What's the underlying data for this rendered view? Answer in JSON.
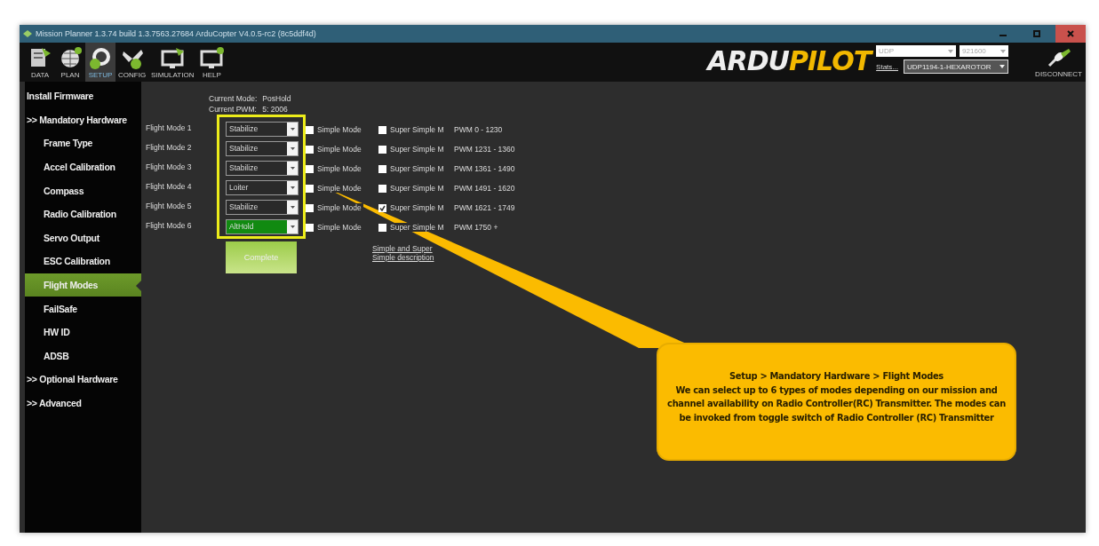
{
  "window": {
    "title": "Mission Planner 1.3.74 build 1.3.7563.27684 ArduCopter V4.0.5-rc2 (8c5ddf4d)"
  },
  "toolbar": {
    "items": [
      {
        "label": "DATA",
        "kind": "data",
        "selected": false
      },
      {
        "label": "PLAN",
        "kind": "plan",
        "selected": false
      },
      {
        "label": "SETUP",
        "kind": "setup",
        "selected": true
      },
      {
        "label": "CONFIG",
        "kind": "config",
        "selected": false
      },
      {
        "label": "SIMULATION",
        "kind": "simulation",
        "selected": false
      },
      {
        "label": "HELP",
        "kind": "help",
        "selected": false
      }
    ]
  },
  "logo": {
    "part_1": "ARDU",
    "part_2": "PILOT"
  },
  "connection": {
    "port": "UDP",
    "baud": "921600",
    "stats_link": "Stats...",
    "target": "UDP1194-1-HEXAROTOR",
    "connect_button": "DISCONNECT"
  },
  "sidebar": {
    "items": [
      {
        "label": "Install Firmware",
        "selected": false
      },
      {
        "label": ">> Mandatory Hardware",
        "selected": false,
        "children": [
          {
            "label": "Frame Type",
            "selected": false
          },
          {
            "label": "Accel Calibration",
            "selected": false
          },
          {
            "label": "Compass",
            "selected": false
          },
          {
            "label": "Radio Calibration",
            "selected": false
          },
          {
            "label": "Servo Output",
            "selected": false
          },
          {
            "label": "ESC Calibration",
            "selected": false
          },
          {
            "label": "Flight Modes",
            "selected": true
          },
          {
            "label": "FailSafe",
            "selected": false
          },
          {
            "label": "HW ID",
            "selected": false
          },
          {
            "label": "ADSB",
            "selected": false
          }
        ]
      },
      {
        "label": ">> Optional Hardware",
        "selected": false
      },
      {
        "label": ">> Advanced",
        "selected": false
      }
    ]
  },
  "flight_modes": {
    "current_mode_label": "Current Mode:",
    "current_mode": "PosHold",
    "current_pwm_label": "Current PWM:",
    "current_pwm": "5: 2006",
    "modes": [
      {
        "label": "Flight Mode 1",
        "mode": "Stabilize",
        "active": false,
        "simple": false,
        "simple_label": "Simple Mode",
        "super_simple": false,
        "super_simple_label": "Super Simple M",
        "pwm": "PWM 0 - 1230"
      },
      {
        "label": "Flight Mode 2",
        "mode": "Stabilize",
        "active": false,
        "simple": false,
        "simple_label": "Simple Mode",
        "super_simple": false,
        "super_simple_label": "Super Simple M",
        "pwm": "PWM 1231 - 1360"
      },
      {
        "label": "Flight Mode 3",
        "mode": "Stabilize",
        "active": false,
        "simple": false,
        "simple_label": "Simple Mode",
        "super_simple": false,
        "super_simple_label": "Super Simple M",
        "pwm": "PWM 1361 - 1490"
      },
      {
        "label": "Flight Mode 4",
        "mode": "Loiter",
        "active": false,
        "simple": false,
        "simple_label": "Simple Mode",
        "super_simple": false,
        "super_simple_label": "Super Simple M",
        "pwm": "PWM 1491 - 1620"
      },
      {
        "label": "Flight Mode 5",
        "mode": "Stabilize",
        "active": false,
        "simple": false,
        "simple_label": "Simple Mode",
        "super_simple": true,
        "super_simple_label": "Super Simple M",
        "pwm": "PWM 1621 - 1749"
      },
      {
        "label": "Flight Mode 6",
        "mode": "AltHold",
        "active": true,
        "simple": false,
        "simple_label": "Simple Mode",
        "super_simple": false,
        "super_simple_label": "Super Simple M",
        "pwm": "PWM 1750 +"
      }
    ],
    "complete_button": "Complete",
    "help_link": "Simple and Super Simple description"
  },
  "callout": {
    "title": "Setup > Mandatory Hardware > Flight Modes",
    "text": "We can select up to 6 types of modes depending on our mission and channel availability on Radio Controller(RC) Transmitter. The modes can be invoked from toggle switch of Radio Controller (RC) Transmitter"
  }
}
